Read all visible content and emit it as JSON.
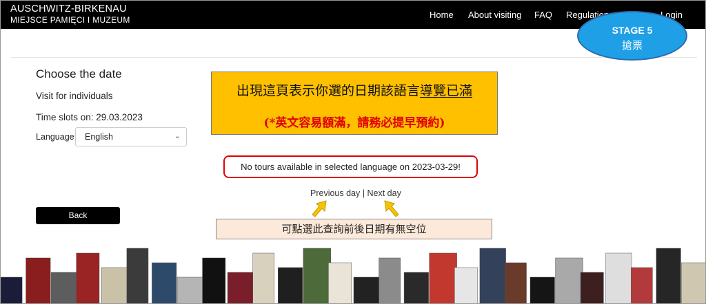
{
  "brand": {
    "line1": "AUSCHWITZ-BIRKENAU",
    "line2": "MIEJSCE PAMIĘCI I MUZEUM"
  },
  "nav": {
    "home": "Home",
    "about": "About visiting",
    "faq": "FAQ",
    "regulations": "Regulations",
    "login": "Login"
  },
  "form": {
    "heading": "Choose the date",
    "visit_type": "Visit for individuals",
    "time_slots": "Time slots on: 29.03.2023",
    "language_label": "Language:",
    "language_value": "English",
    "back_label": "Back"
  },
  "note": {
    "line1_prefix": "出現這頁表示你選的日期該語言",
    "line1_underlined": "導覽已滿",
    "line2": "(*英文容易額滿，請務必提早預約)"
  },
  "message": "No tours available in selected language on 2023-03-29!",
  "daynav": {
    "previous": "Previous day",
    "separator": "|",
    "next": "Next day"
  },
  "tip": "可點選此查詢前後日期有無空位",
  "stage": {
    "title": "STAGE 5",
    "subtitle": "搶票"
  },
  "colors": {
    "topbar": "#000000",
    "note_bg": "#ffc000",
    "note_red": "#e00000",
    "stage_fill": "#1fa0e6",
    "tip_bg": "#fde9d9",
    "arrow": "#f5c400"
  },
  "books": [
    {
      "color": "#1b1b3a"
    },
    {
      "color": "#8a1d1d"
    },
    {
      "color": "#5d5d5d"
    },
    {
      "color": "#9a2424"
    },
    {
      "color": "#c9c1a8"
    },
    {
      "color": "#3b3b3b"
    },
    {
      "color": "#2e4a6b"
    },
    {
      "color": "#b5b5b5"
    },
    {
      "color": "#111111"
    },
    {
      "color": "#7a1e2c"
    },
    {
      "color": "#d8d1bd"
    },
    {
      "color": "#1f1f1f"
    },
    {
      "color": "#4d6b3a"
    },
    {
      "color": "#e9e4d7"
    },
    {
      "color": "#222222"
    },
    {
      "color": "#8b8b8b"
    },
    {
      "color": "#2a2a2a"
    },
    {
      "color": "#c2382f"
    },
    {
      "color": "#e6e6e6"
    },
    {
      "color": "#33425a"
    },
    {
      "color": "#6a3a2a"
    },
    {
      "color": "#151515"
    },
    {
      "color": "#a9a9a9"
    },
    {
      "color": "#3d1f1f"
    },
    {
      "color": "#dedede"
    },
    {
      "color": "#b23a3a"
    },
    {
      "color": "#262626"
    },
    {
      "color": "#cfc7b0"
    }
  ]
}
